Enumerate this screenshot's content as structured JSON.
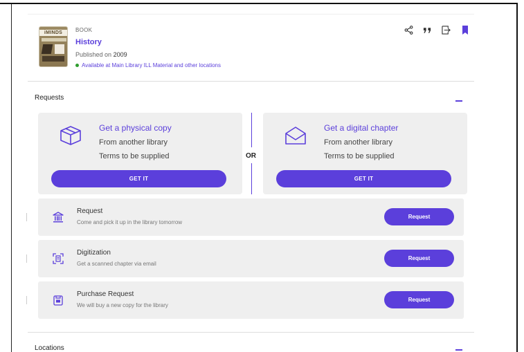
{
  "record": {
    "cover_brand": "iMINDS",
    "type": "BOOK",
    "title": "History",
    "published_label": "Published on",
    "published_year": "2009",
    "availability": "Available at Main Library ILL Material and other locations",
    "availability_color": "#2e9d2e"
  },
  "actions": [
    "share-icon",
    "citation-icon",
    "send-to-icon",
    "bookmark-icon"
  ],
  "requests_section": {
    "title": "Requests",
    "options": [
      {
        "heading": "Get a physical copy",
        "line1": "From another library",
        "line2": "Terms to be supplied",
        "button": "GET IT",
        "icon": "box-icon"
      },
      {
        "heading": "Get a digital chapter",
        "line1": "From another library",
        "line2": "Terms to be supplied",
        "button": "GET IT",
        "icon": "envelope-icon"
      }
    ],
    "or_label": "OR",
    "rows": [
      {
        "title": "Request",
        "description": "Come and pick it up in the library tomorrow",
        "button": "Request",
        "icon": "library-icon"
      },
      {
        "title": "Digitization",
        "description": "Get a scanned chapter via email",
        "button": "Request",
        "icon": "scan-icon"
      },
      {
        "title": "Purchase Request",
        "description": "We will buy a new copy for the library",
        "button": "Request",
        "icon": "purchase-icon"
      }
    ]
  },
  "locations_section": {
    "title": "Locations"
  },
  "colors": {
    "accent": "#5b3fdb",
    "card_bg": "#efefef"
  }
}
